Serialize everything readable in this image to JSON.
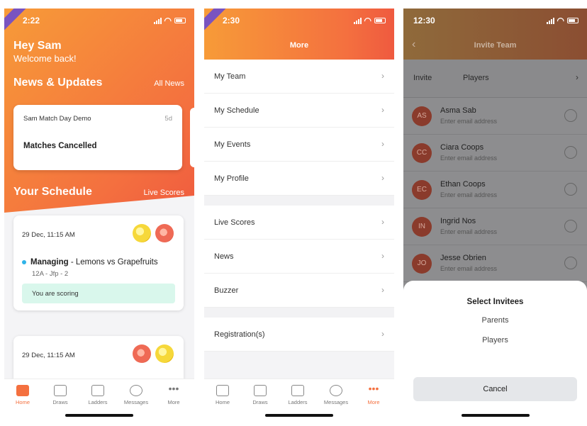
{
  "screen1": {
    "status_time": "2:22",
    "greeting": "Hey Sam",
    "welcome": "Welcome back!",
    "news_title": "News & Updates",
    "news_link": "All News",
    "news_card": {
      "source": "Sam Match Day Demo",
      "age": "5d",
      "headline": "Matches Cancelled"
    },
    "schedule_title": "Your Schedule",
    "schedule_link": "Live Scores",
    "matches": [
      {
        "datetime": "29 Dec, 11:15 AM",
        "role": "Managing",
        "teams": " - Lemons vs Grapefruits",
        "sub": "12A - Jfp - 2",
        "scoring": "You are scoring"
      },
      {
        "datetime": "29 Dec, 11:15 AM"
      }
    ]
  },
  "screen2": {
    "status_time": "2:30",
    "title": "More",
    "group1": [
      "My Team",
      "My Schedule",
      "My Events",
      "My Profile"
    ],
    "group2": [
      "Live Scores",
      "News",
      "Buzzer"
    ],
    "group3": [
      "Registration(s)"
    ]
  },
  "screen3": {
    "status_time": "12:30",
    "title": "Invite Team",
    "invite_label": "Invite",
    "invite_value": "Players",
    "people": [
      {
        "initials": "AS",
        "name": "Asma Sab",
        "email": "Enter email address"
      },
      {
        "initials": "CC",
        "name": "Ciara Coops",
        "email": "Enter email address"
      },
      {
        "initials": "EC",
        "name": "Ethan Coops",
        "email": "Enter email address"
      },
      {
        "initials": "IN",
        "name": "Ingrid Nos",
        "email": "Enter email address"
      },
      {
        "initials": "JO",
        "name": "Jesse Obrien",
        "email": "Enter email address"
      }
    ],
    "sheet_title": "Select Invitees",
    "sheet_options": [
      "Parents",
      "Players"
    ],
    "cancel": "Cancel"
  },
  "tabbar": [
    "Home",
    "Draws",
    "Ladders",
    "Messages",
    "More"
  ],
  "chevron": "›",
  "back_arrow": "‹",
  "colors": {
    "accent": "#f4703f",
    "accent_light": "#f79b38",
    "scoring_bg": "#d9f7ec",
    "dot": "#2fb3e8"
  }
}
